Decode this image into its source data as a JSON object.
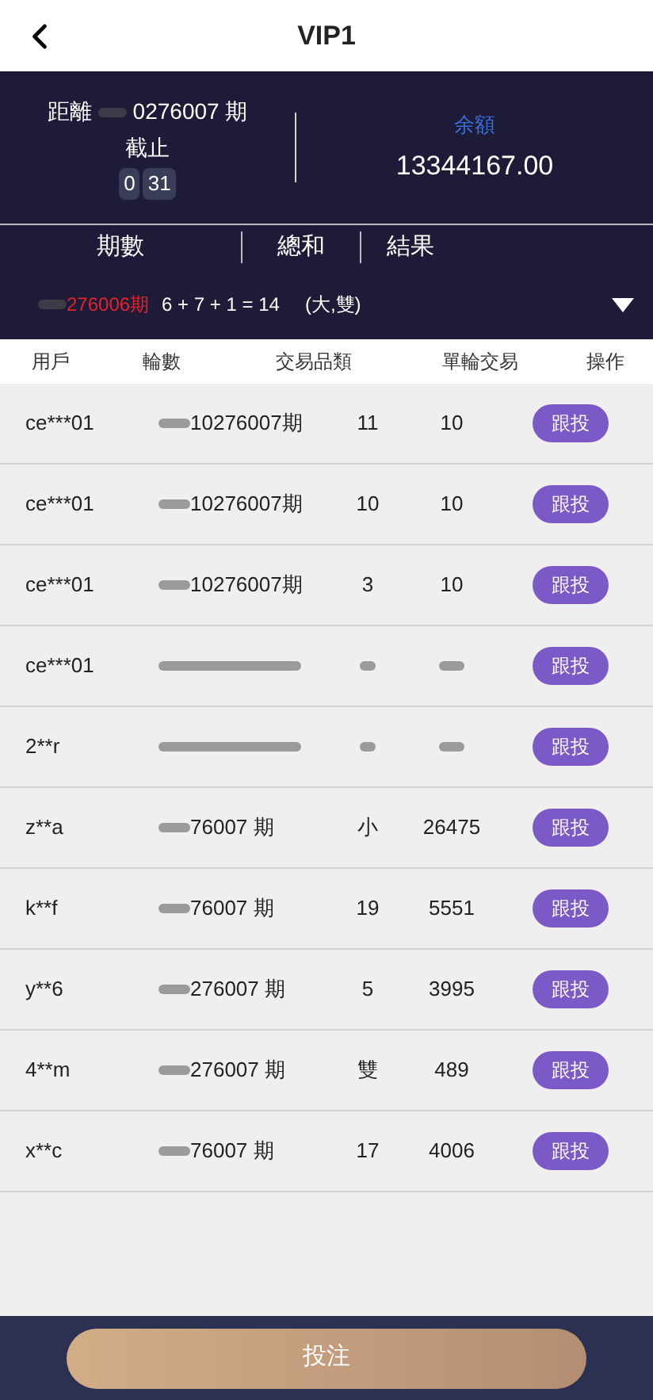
{
  "header": {
    "title": "VIP1"
  },
  "countdown": {
    "prefix": "距離",
    "period": "0276007 期",
    "label": "截止",
    "digits": [
      "0",
      "31"
    ]
  },
  "balance": {
    "label": "余額",
    "value": "13344167.00"
  },
  "results_header": [
    "期數",
    "總和",
    "結果"
  ],
  "latest": {
    "period": "276006期",
    "sum": "6 + 7 + 1 = 14",
    "result": "(大,雙)",
    "expanded": false
  },
  "table": {
    "columns": [
      "用戶",
      "輪數",
      "交易品類",
      "單輪交易",
      "操作"
    ],
    "rows": [
      {
        "user": "ce***01",
        "round": "10276007期",
        "type": "11",
        "amount": "10",
        "action": "跟投"
      },
      {
        "user": "ce***01",
        "round": "10276007期",
        "type": "10",
        "amount": "10",
        "action": "跟投"
      },
      {
        "user": "ce***01",
        "round": "10276007期",
        "type": "3",
        "amount": "10",
        "action": "跟投"
      },
      {
        "user": "ce***01",
        "action": "跟投"
      },
      {
        "user": "2**r",
        "action": "跟投"
      },
      {
        "user": "z**a",
        "round": "76007 期",
        "type": "小",
        "amount": "26475",
        "action": "跟投"
      },
      {
        "user": "k**f",
        "round": "76007 期",
        "type": "19",
        "amount": "5551",
        "action": "跟投"
      },
      {
        "user": "y**6",
        "round": "276007 期",
        "type": "5",
        "amount": "3995",
        "action": "跟投"
      },
      {
        "user": "4**m",
        "round": "276007 期",
        "type": "雙",
        "amount": "489",
        "action": "跟投"
      },
      {
        "user": "x**c",
        "round": "76007 期",
        "type": "17",
        "amount": "4006",
        "action": "跟投"
      }
    ]
  },
  "submit": {
    "label": "投注"
  }
}
